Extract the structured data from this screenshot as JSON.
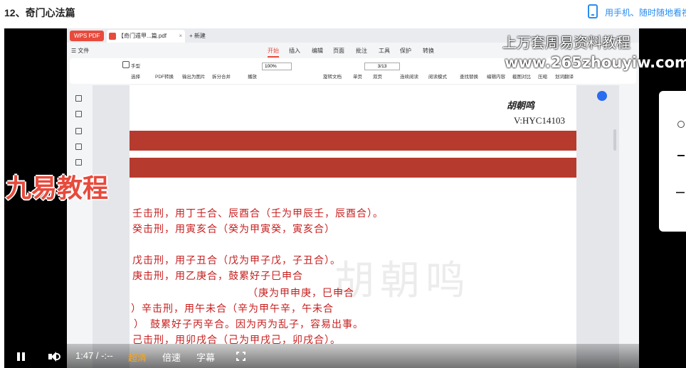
{
  "header": {
    "title": "12、奇门心法篇",
    "mobile_link": "用手机、随时随地看视"
  },
  "wps": {
    "tab_app": "WPS PDF",
    "tab_doc": "【奇门遁甲...篇.pdf",
    "tab_new": "+ 新建",
    "menu": [
      "☰ 文件",
      "开始",
      "插入",
      "编辑",
      "页面",
      "批注",
      "工具",
      "保护",
      "转换"
    ],
    "toolbar": {
      "hand": "手型",
      "select": "选择",
      "pdf_convert": "PDF转换",
      "export_image": "输出为图片",
      "split_merge": "拆分合并",
      "play": "播放",
      "zoom": "100%",
      "rotate": "旋转文档",
      "single": "单页",
      "double": "双页",
      "continuous": "连续阅读",
      "read_mode": "阅读模式",
      "page": "3/13",
      "find_replace": "查找替换",
      "edit_content": "编辑内容",
      "screenshot": "截图对比",
      "compress": "压缩",
      "translate": "划词翻译"
    }
  },
  "document": {
    "author": "胡朝鸣",
    "vid": "V:HYC14103",
    "watermark": "胡朝鸣",
    "lines": [
      "壬击刑，用丁壬合、辰酉合（壬为甲辰壬，辰酉合）。",
      "癸击刑，用寅亥合（癸为甲寅癸，寅亥合）",
      "戊击刑，用子丑合（戊为甲子戊，子丑合）。",
      "庚击刑，用乙庚合，鼓累好子巳申合",
      "（庚为甲申庚，巳申合",
      "）辛击刑，用午未合（辛为甲午辛，午未合",
      "）　鼓累好子丙辛合。因为丙为乱子，容易出事。",
      "己击刑，用卯戌合（己为甲戌己，卯戌合）。"
    ]
  },
  "overlays": {
    "brand_cn": "上万套周易资料教程",
    "brand_url": "www.265zhouyiw.com",
    "left_brand": "九易教程"
  },
  "player": {
    "time": "1:47 / -:--",
    "quality": "超清",
    "speed": "倍速",
    "subtitle": "字幕"
  }
}
